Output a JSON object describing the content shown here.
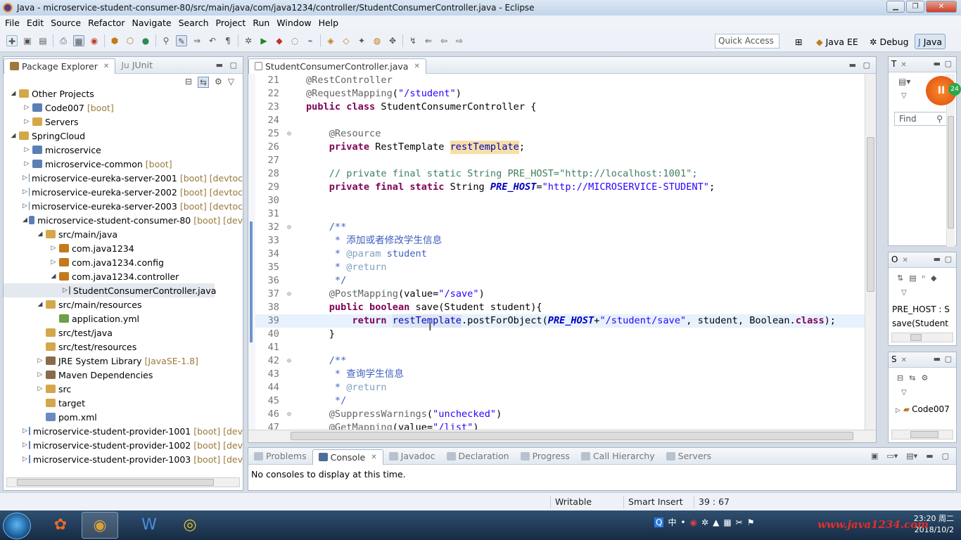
{
  "window": {
    "title": "Java - microservice-student-consumer-80/src/main/java/com/java1234/controller/StudentConsumerController.java - Eclipse"
  },
  "menu": [
    "File",
    "Edit",
    "Source",
    "Refactor",
    "Navigate",
    "Search",
    "Project",
    "Run",
    "Window",
    "Help"
  ],
  "toolbar": {
    "quick_access": "Quick Access",
    "perspectives": [
      "Java EE",
      "Debug",
      "Java"
    ]
  },
  "explorer": {
    "tabs": [
      "Package Explorer",
      "JUnit"
    ],
    "nodes": [
      {
        "label": "Other Projects",
        "dec": "",
        "level": 0,
        "tw": "◢",
        "icon": "folder"
      },
      {
        "label": "Code007",
        "dec": "[boot]",
        "level": 1,
        "tw": "▷",
        "icon": "proj"
      },
      {
        "label": "Servers",
        "dec": "",
        "level": 1,
        "tw": "▷",
        "icon": "folder"
      },
      {
        "label": "SpringCloud",
        "dec": "",
        "level": 0,
        "tw": "◢",
        "icon": "folder"
      },
      {
        "label": "microservice",
        "dec": "",
        "level": 1,
        "tw": "▷",
        "icon": "proj"
      },
      {
        "label": "microservice-common",
        "dec": "[boot]",
        "level": 1,
        "tw": "▷",
        "icon": "proj"
      },
      {
        "label": "microservice-eureka-server-2001",
        "dec": "[boot] [devtoc",
        "level": 1,
        "tw": "▷",
        "icon": "proj"
      },
      {
        "label": "microservice-eureka-server-2002",
        "dec": "[boot] [devtoc",
        "level": 1,
        "tw": "▷",
        "icon": "proj"
      },
      {
        "label": "microservice-eureka-server-2003",
        "dec": "[boot] [devtoc",
        "level": 1,
        "tw": "▷",
        "icon": "proj"
      },
      {
        "label": "microservice-student-consumer-80",
        "dec": "[boot] [dev",
        "level": 1,
        "tw": "◢",
        "icon": "proj"
      },
      {
        "label": "src/main/java",
        "dec": "",
        "level": 2,
        "tw": "◢",
        "icon": "src"
      },
      {
        "label": "com.java1234",
        "dec": "",
        "level": 3,
        "tw": "▷",
        "icon": "pkg"
      },
      {
        "label": "com.java1234.config",
        "dec": "",
        "level": 3,
        "tw": "▷",
        "icon": "pkg"
      },
      {
        "label": "com.java1234.controller",
        "dec": "",
        "level": 3,
        "tw": "◢",
        "icon": "pkg"
      },
      {
        "label": "StudentConsumerController.java",
        "dec": "",
        "level": 4,
        "tw": "▷",
        "icon": "java",
        "selected": true
      },
      {
        "label": "src/main/resources",
        "dec": "",
        "level": 2,
        "tw": "◢",
        "icon": "src"
      },
      {
        "label": "application.yml",
        "dec": "",
        "level": 3,
        "tw": "",
        "icon": "yml"
      },
      {
        "label": "src/test/java",
        "dec": "",
        "level": 2,
        "tw": "",
        "icon": "src"
      },
      {
        "label": "src/test/resources",
        "dec": "",
        "level": 2,
        "tw": "",
        "icon": "src"
      },
      {
        "label": "JRE System Library",
        "dec": "[JavaSE-1.8]",
        "level": 2,
        "tw": "▷",
        "icon": "lib"
      },
      {
        "label": "Maven Dependencies",
        "dec": "",
        "level": 2,
        "tw": "▷",
        "icon": "lib"
      },
      {
        "label": "src",
        "dec": "",
        "level": 2,
        "tw": "▷",
        "icon": "folder"
      },
      {
        "label": "target",
        "dec": "",
        "level": 2,
        "tw": "",
        "icon": "folder"
      },
      {
        "label": "pom.xml",
        "dec": "",
        "level": 2,
        "tw": "",
        "icon": "xml"
      },
      {
        "label": "microservice-student-provider-1001",
        "dec": "[boot] [dev",
        "level": 1,
        "tw": "▷",
        "icon": "proj"
      },
      {
        "label": "microservice-student-provider-1002",
        "dec": "[boot] [dev",
        "level": 1,
        "tw": "▷",
        "icon": "proj"
      },
      {
        "label": "microservice-student-provider-1003",
        "dec": "[boot] [dev",
        "level": 1,
        "tw": "▷",
        "icon": "proj"
      }
    ]
  },
  "editor": {
    "tab": "StudentConsumerController.java",
    "lines": [
      {
        "n": "21",
        "t": [
          [
            "ann",
            "@RestController"
          ]
        ]
      },
      {
        "n": "22",
        "t": [
          [
            "ann",
            "@RequestMapping"
          ],
          [
            "",
            "("
          ],
          [
            "str",
            "\"/student\""
          ],
          [
            "",
            ")"
          ]
        ]
      },
      {
        "n": "23",
        "t": [
          [
            "kw",
            "public class"
          ],
          [
            "",
            " StudentConsumerController {"
          ]
        ]
      },
      {
        "n": "24",
        "t": []
      },
      {
        "n": "25",
        "fold": true,
        "t": [
          [
            "",
            "    "
          ],
          [
            "ann",
            "@Resource"
          ]
        ]
      },
      {
        "n": "26",
        "t": [
          [
            "",
            "    "
          ],
          [
            "kw",
            "private"
          ],
          [
            "",
            " RestTemplate "
          ],
          [
            "fld hl",
            "restTemplate"
          ],
          [
            "",
            ";"
          ]
        ]
      },
      {
        "n": "27",
        "t": []
      },
      {
        "n": "28",
        "t": [
          [
            "",
            "    "
          ],
          [
            "cmt",
            "// private final static String PRE_HOST=\"http://localhost:1001\";"
          ]
        ]
      },
      {
        "n": "29",
        "t": [
          [
            "",
            "    "
          ],
          [
            "kw",
            "private final static"
          ],
          [
            "",
            " String "
          ],
          [
            "sfld",
            "PRE_HOST"
          ],
          [
            "",
            "="
          ],
          [
            "str",
            "\"http://MICROSERVICE-STUDENT\""
          ],
          [
            "",
            ";"
          ]
        ]
      },
      {
        "n": "30",
        "t": []
      },
      {
        "n": "31",
        "t": []
      },
      {
        "n": "32",
        "fold": true,
        "t": [
          [
            "",
            "    "
          ],
          [
            "jd",
            "/**"
          ]
        ]
      },
      {
        "n": "33",
        "t": [
          [
            "",
            "     "
          ],
          [
            "jd",
            "* 添加或者修改学生信息"
          ]
        ]
      },
      {
        "n": "34",
        "t": [
          [
            "",
            "     "
          ],
          [
            "jd",
            "* "
          ],
          [
            "jdtag",
            "@param"
          ],
          [
            "jd",
            " student"
          ]
        ]
      },
      {
        "n": "35",
        "t": [
          [
            "",
            "     "
          ],
          [
            "jd",
            "* "
          ],
          [
            "jdtag",
            "@return"
          ]
        ]
      },
      {
        "n": "36",
        "t": [
          [
            "",
            "     "
          ],
          [
            "jd",
            "*/"
          ]
        ]
      },
      {
        "n": "37",
        "fold": true,
        "t": [
          [
            "",
            "    "
          ],
          [
            "ann",
            "@PostMapping"
          ],
          [
            "",
            "(value="
          ],
          [
            "str",
            "\"/save\""
          ],
          [
            "",
            ")"
          ]
        ]
      },
      {
        "n": "38",
        "t": [
          [
            "",
            "    "
          ],
          [
            "kw",
            "public boolean"
          ],
          [
            "",
            " save(Student student){"
          ]
        ]
      },
      {
        "n": "39",
        "cur": true,
        "t": [
          [
            "",
            "        "
          ],
          [
            "kw",
            "return"
          ],
          [
            "",
            " "
          ],
          [
            "fld hl2",
            "restTemplate"
          ],
          [
            "",
            ".postForObject("
          ],
          [
            "sfld",
            "PRE_HOST"
          ],
          [
            "",
            "+"
          ],
          [
            "str",
            "\"/student/save\""
          ],
          [
            "",
            ", student, Boolean."
          ],
          [
            "kw",
            "class"
          ],
          [
            "",
            ");"
          ]
        ]
      },
      {
        "n": "40",
        "t": [
          [
            "",
            "    }"
          ]
        ]
      },
      {
        "n": "41",
        "t": []
      },
      {
        "n": "42",
        "fold": true,
        "t": [
          [
            "",
            "    "
          ],
          [
            "jd",
            "/**"
          ]
        ]
      },
      {
        "n": "43",
        "t": [
          [
            "",
            "     "
          ],
          [
            "jd",
            "* 查询学生信息"
          ]
        ]
      },
      {
        "n": "44",
        "t": [
          [
            "",
            "     "
          ],
          [
            "jd",
            "* "
          ],
          [
            "jdtag",
            "@return"
          ]
        ]
      },
      {
        "n": "45",
        "t": [
          [
            "",
            "     "
          ],
          [
            "jd",
            "*/"
          ]
        ]
      },
      {
        "n": "46",
        "fold": true,
        "t": [
          [
            "",
            "    "
          ],
          [
            "ann",
            "@SuppressWarnings"
          ],
          [
            "",
            "("
          ],
          [
            "str",
            "\"unchecked\""
          ],
          [
            "",
            ")"
          ]
        ]
      },
      {
        "n": "47",
        "t": [
          [
            "",
            "    "
          ],
          [
            "ann",
            "@GetMapping"
          ],
          [
            "",
            "(value="
          ],
          [
            "str",
            "\"/list\""
          ],
          [
            "",
            ")"
          ]
        ]
      }
    ]
  },
  "bottom": {
    "tabs": [
      "Problems",
      "Console",
      "Javadoc",
      "Declaration",
      "Progress",
      "Call Hierarchy",
      "Servers"
    ],
    "active": "Console",
    "message": "No consoles to display at this time."
  },
  "right": {
    "top_tab": "T",
    "find": "Find",
    "outline_tab": "O",
    "outline_items": [
      "PRE_HOST : S",
      "save(Student"
    ],
    "servers_tab": "S",
    "servers_items": [
      "Code007"
    ],
    "record_label": "II",
    "record_badge": "24"
  },
  "status": {
    "writable": "Writable",
    "insert": "Smart Insert",
    "position": "39 : 67"
  },
  "taskbar": {
    "tray_lang": "中",
    "clock_time": "23:20 周二",
    "clock_date": "2018/10/2",
    "watermark": "www.java1234.com"
  }
}
